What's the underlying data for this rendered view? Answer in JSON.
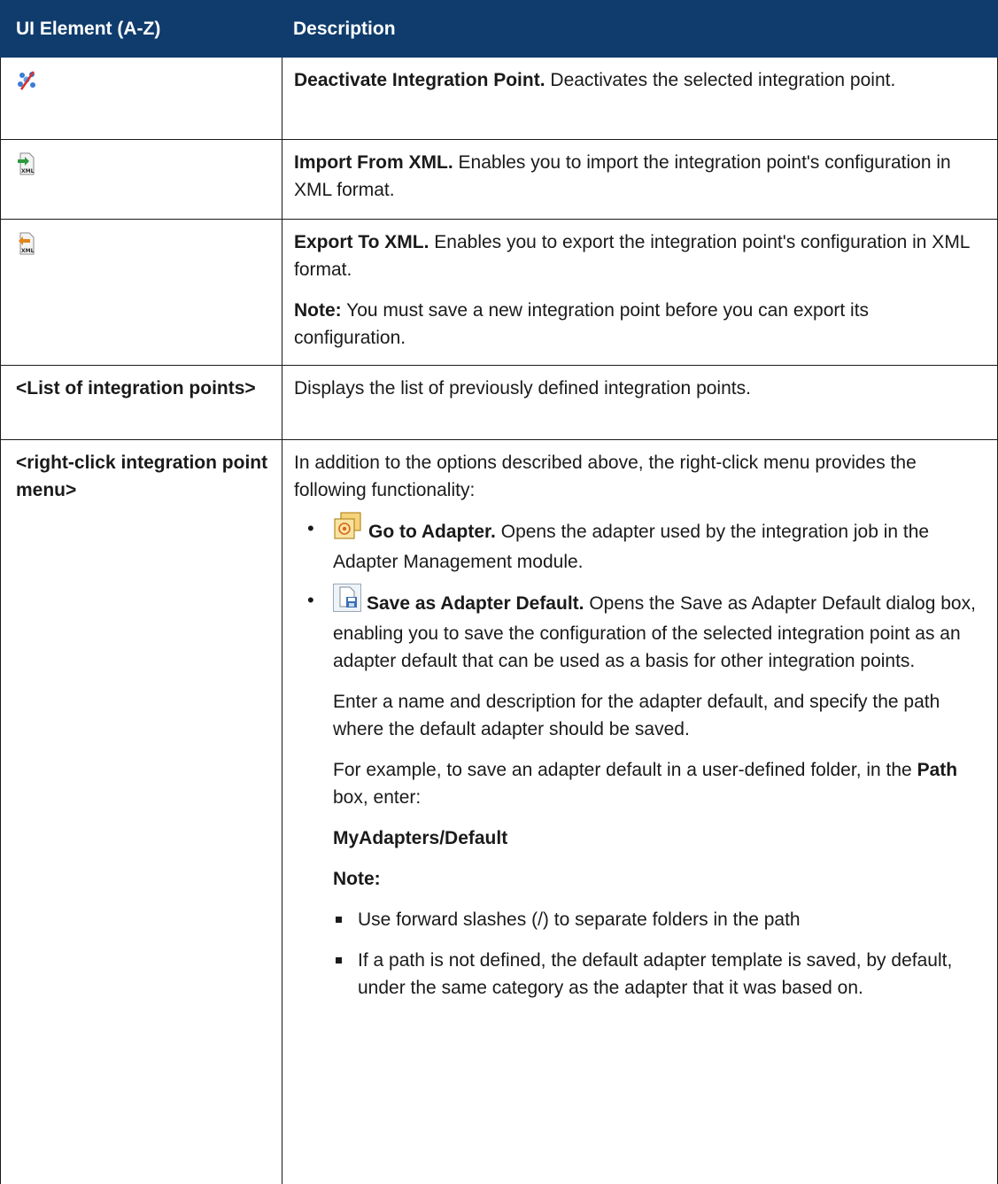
{
  "header": {
    "col1": "UI Element (A-Z)",
    "col2": "Description"
  },
  "rows": {
    "deactivate": {
      "icon": "deactivate-integration-icon",
      "title": "Deactivate Integration Point.",
      "text": " Deactivates the selected integration point."
    },
    "import": {
      "icon": "import-xml-icon",
      "title": "Import From XML.",
      "text": " Enables you to import the integration point's configuration in XML format."
    },
    "export": {
      "icon": "export-xml-icon",
      "title": "Export To XML.",
      "text": " Enables you to export the integration point's configuration in XML format.",
      "note_label": "Note:",
      "note_text": " You must save a new integration point before you can export its configuration."
    },
    "list": {
      "element": "<List of integration points>",
      "text": "Displays the list of previously defined integration points."
    },
    "rightclick": {
      "element": "<right-click integration point menu>",
      "intro": "In addition to the options described above, the right-click menu provides the following functionality:",
      "item1_icon": "go-to-adapter-icon",
      "item1_title": "Go to Adapter.",
      "item1_text": " Opens the adapter used by the integration job in the Adapter Management module.",
      "item2_icon": "save-adapter-default-icon",
      "item2_title": "Save as Adapter Default.",
      "item2_text": " Opens the Save as Adapter Default dialog box, enabling you to save the configuration of the selected integration point as an adapter default that can be used as a basis for other integration points.",
      "para1": "Enter a name and description for the adapter default, and specify the path where the default adapter should be saved.",
      "para2_a": "For example, to save an adapter default in a user-defined folder, in the ",
      "para2_b": "Path",
      "para2_c": " box, enter:",
      "path_example": "MyAdapters/Default",
      "note_label": "Note:",
      "sub1": "Use forward slashes (/) to separate folders in the path",
      "sub2": "If a path is not defined, the default adapter template is saved, by default, under the same category as the adapter that it was based on."
    }
  },
  "colors": {
    "header_bg": "#0f3c6d",
    "header_text": "#ffffff"
  }
}
